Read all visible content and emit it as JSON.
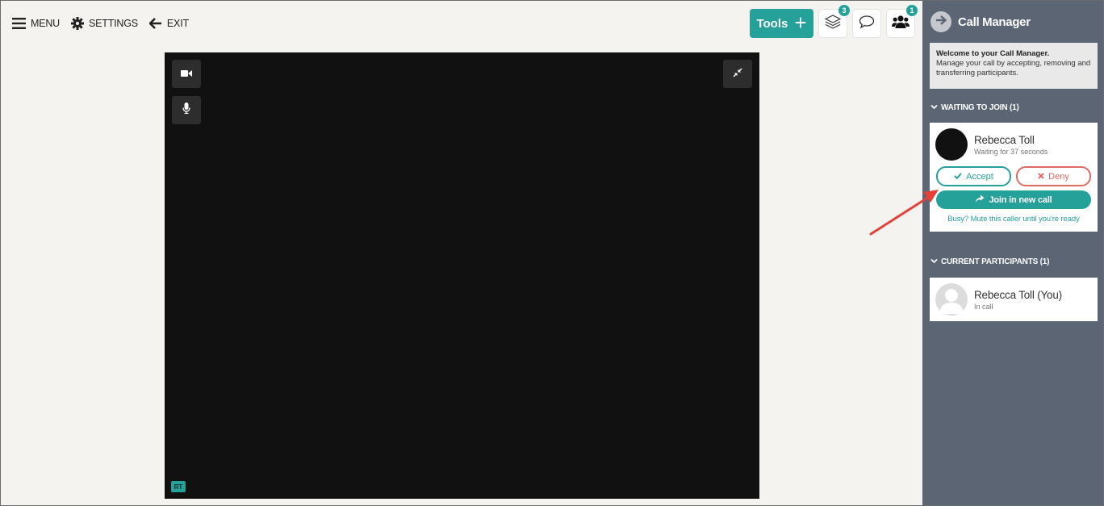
{
  "nav": {
    "menu_label": "MENU",
    "settings_label": "SETTINGS",
    "exit_label": "EXIT"
  },
  "toolbar": {
    "tools_label": "Tools",
    "layers_badge": "3",
    "participants_badge": "1"
  },
  "video": {
    "initials_tag": "RT"
  },
  "call_manager": {
    "title": "Call Manager",
    "welcome_title": "Welcome to your Call Manager.",
    "welcome_text": "Manage your call by accepting, removing and transferring participants.",
    "waiting_header": "WAITING TO JOIN (1)",
    "waiting": {
      "name": "Rebecca Toll",
      "status": "Waiting for 37 seconds",
      "accept_label": "Accept",
      "deny_label": "Deny",
      "join_new_label": "Join in new call",
      "mute_link": "Busy? Mute this caller until you're ready"
    },
    "participants_header": "CURRENT PARTICIPANTS (1)",
    "participant": {
      "name": "Rebecca Toll (You)",
      "status": "In call"
    }
  },
  "colors": {
    "accent": "#25a19a",
    "deny": "#e06a64",
    "sidebar_bg": "#5b6574",
    "video_bg": "#111111",
    "annotation_arrow": "#e5413b"
  }
}
